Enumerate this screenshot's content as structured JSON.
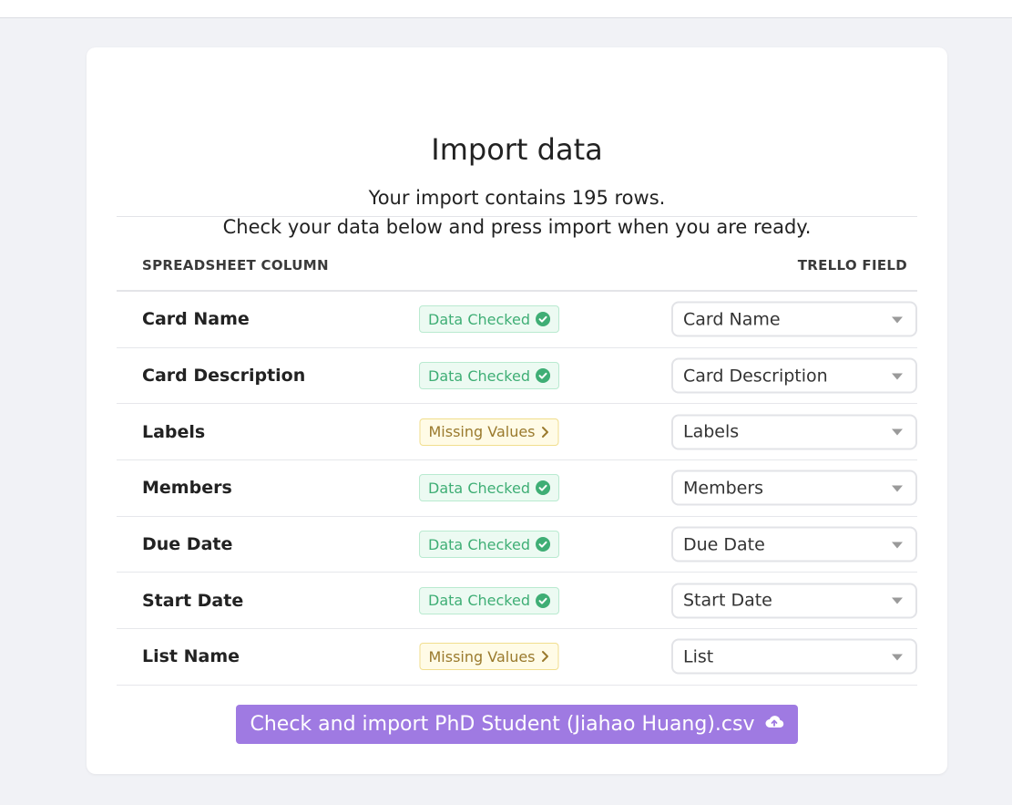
{
  "page": {
    "title": "Import data",
    "subtitle_line1": "Your import contains 195 rows.",
    "subtitle_line2": "Check your data below and press import when you are ready."
  },
  "table": {
    "left_header": "SPREADSHEET COLUMN",
    "right_header": "TRELLO FIELD",
    "rows": [
      {
        "column": "Card Name",
        "status": "Data Checked",
        "status_type": "ok",
        "field": "Card Name"
      },
      {
        "column": "Card Description",
        "status": "Data Checked",
        "status_type": "ok",
        "field": "Card Description"
      },
      {
        "column": "Labels",
        "status": "Missing Values",
        "status_type": "warn",
        "field": "Labels"
      },
      {
        "column": "Members",
        "status": "Data Checked",
        "status_type": "ok",
        "field": "Members"
      },
      {
        "column": "Due Date",
        "status": "Data Checked",
        "status_type": "ok",
        "field": "Due Date"
      },
      {
        "column": "Start Date",
        "status": "Data Checked",
        "status_type": "ok",
        "field": "Start Date"
      },
      {
        "column": "List Name",
        "status": "Missing Values",
        "status_type": "warn",
        "field": "List"
      }
    ]
  },
  "import_button": {
    "label": "Check and import PhD Student (Jiahao Huang).csv",
    "icon": "cloud-upload-icon"
  },
  "colors": {
    "accent": "#9f7ae2",
    "ok": "#3fae75",
    "warn": "#9a7a2d",
    "background": "#f1f2f6"
  }
}
